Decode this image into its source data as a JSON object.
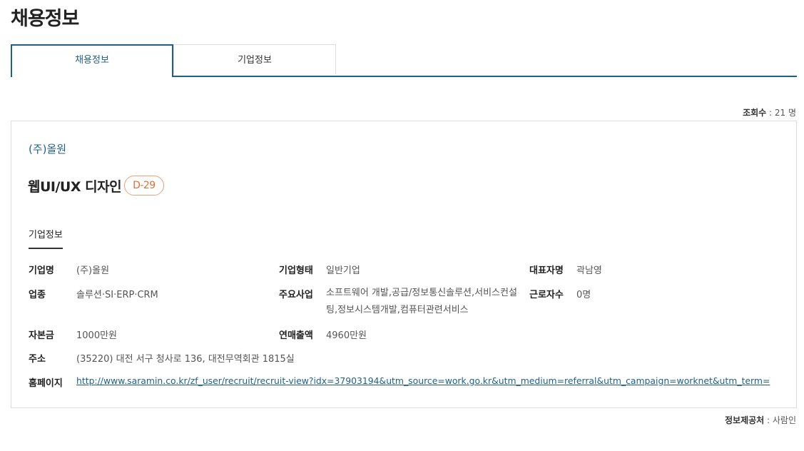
{
  "page_title": "채용정보",
  "tabs": [
    {
      "label": "채용정보",
      "active": true
    },
    {
      "label": "기업정보",
      "active": false
    }
  ],
  "view_count": {
    "label": "조회수",
    "value": " : 21 명"
  },
  "company_name": "(주)올원",
  "job": {
    "title": "웹UI/UX 디자인",
    "dday": "D-29"
  },
  "section_title": "기업정보",
  "fields": {
    "company_name": {
      "label": "기업명",
      "value": "(주)올원"
    },
    "company_type": {
      "label": "기업형태",
      "value": "일반기업"
    },
    "ceo": {
      "label": "대표자명",
      "value": "곽남영"
    },
    "industry": {
      "label": "업종",
      "value": "솔루션·SI·ERP·CRM"
    },
    "business": {
      "label": "주요사업",
      "value": "소프트웨어 개발,공급/정보통신솔루션,서비스컨설팅,정보시스템개발,컴퓨터관련서비스"
    },
    "employees": {
      "label": "근로자수",
      "value": "0명"
    },
    "capital": {
      "label": "자본금",
      "value": "1000만원"
    },
    "revenue": {
      "label": "연매출액",
      "value": "4960만원"
    },
    "address": {
      "label": "주소",
      "value": "(35220) 대전 서구 청사로 136, 대전무역회관 1815실"
    },
    "homepage": {
      "label": "홈페이지",
      "value": "http://www.saramin.co.kr/zf_user/recruit/recruit-view?idx=37903194&utm_source=work.go.kr&utm_medium=referral&utm_campaign=worknet&utm_term="
    }
  },
  "provider": {
    "label": "정보제공처",
    "value": " : 사람인"
  },
  "colors": {
    "accent": "#1f5f8b",
    "dday": "#d8703a"
  }
}
